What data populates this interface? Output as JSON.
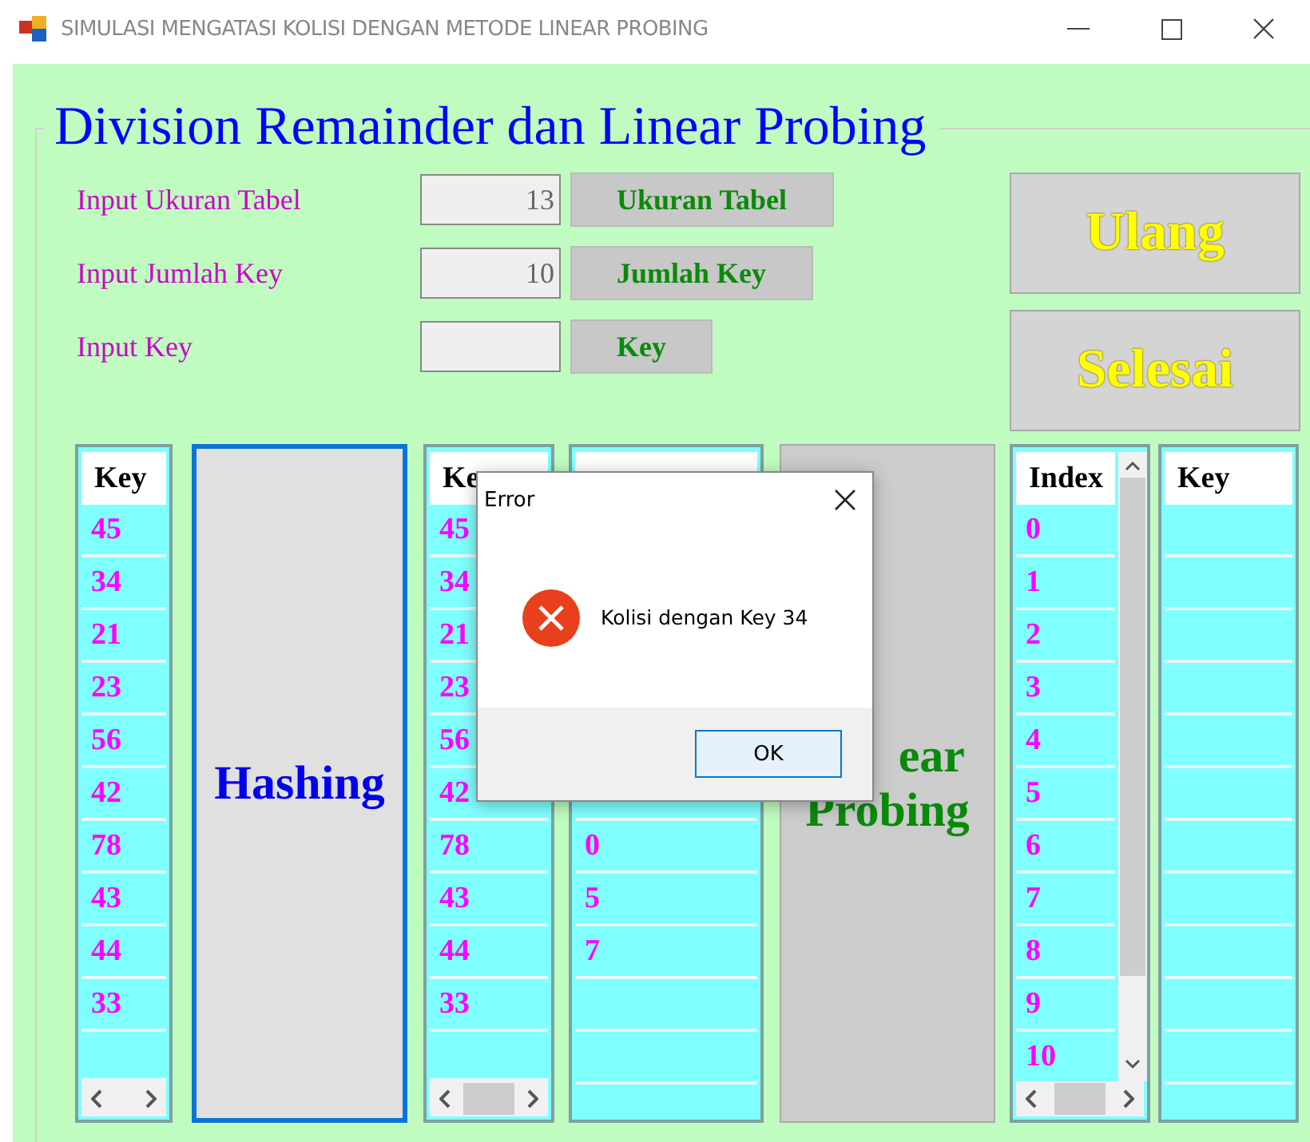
{
  "window": {
    "title": "SIMULASI MENGATASI KOLISI DENGAN METODE LINEAR PROBING"
  },
  "group_title": "Division Remainder dan Linear Probing",
  "inputs": [
    {
      "label": "Input Ukuran Tabel",
      "value": "13",
      "button": "Ukuran Tabel"
    },
    {
      "label": "Input Jumlah Key",
      "value": "10",
      "button": "Jumlah Key"
    },
    {
      "label": "Input Key",
      "button": "Key"
    }
  ],
  "side_buttons": [
    "Ulang",
    "Selesai"
  ],
  "lists": [
    {
      "kind": "hlist",
      "header": "Key",
      "cells": [
        "45",
        "34",
        "21",
        "23",
        "56",
        "42",
        "78",
        "43",
        "44",
        "33"
      ]
    },
    {
      "kind": "action",
      "label": "Hashing",
      "focused": true
    },
    {
      "kind": "hlist-thumb",
      "header": "Ke",
      "cells": [
        "45",
        "34",
        "21",
        "23",
        "56",
        "42",
        "78",
        "43",
        "44",
        "33"
      ]
    },
    {
      "kind": "list",
      "cells": [
        null,
        null,
        null,
        null,
        null,
        null,
        "0",
        "5",
        "7"
      ]
    },
    {
      "kind": "action",
      "label": "ear",
      "label_2": "Probing",
      "focused": false
    },
    {
      "kind": "vlist",
      "header": "Index",
      "cells": [
        "0",
        "1",
        "2",
        "3",
        "4",
        "5",
        "6",
        "7",
        "8",
        "9",
        "10"
      ]
    },
    {
      "kind": "list",
      "header": "Key"
    }
  ],
  "dialog": {
    "title": "Error",
    "message": "Kolisi dengan Key 34",
    "button": "OK"
  }
}
